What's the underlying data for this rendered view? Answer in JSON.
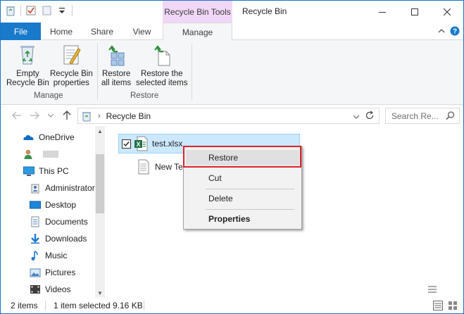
{
  "window": {
    "contextual_tab_group": "Recycle Bin Tools",
    "title": "Recycle Bin",
    "controls": [
      "minimize-icon",
      "maximize-icon",
      "close-icon"
    ]
  },
  "tabs": {
    "file": "File",
    "home": "Home",
    "share": "Share",
    "view": "View",
    "manage": "Manage"
  },
  "ribbon": {
    "manage_group": {
      "label": "Manage",
      "empty_recycle_bin": [
        "Empty",
        "Recycle Bin"
      ],
      "recycle_bin_properties": [
        "Recycle Bin",
        "properties"
      ]
    },
    "restore_group": {
      "label": "Restore",
      "restore_all": [
        "Restore",
        "all items"
      ],
      "restore_selected": [
        "Restore the",
        "selected items"
      ]
    }
  },
  "address": {
    "path": "Recycle Bin",
    "search_placeholder": "Search Re..."
  },
  "navpane": {
    "items": [
      {
        "label": "OneDrive",
        "icon": "onedrive-icon"
      },
      {
        "label": "",
        "icon": "user-icon"
      },
      {
        "label": "This PC",
        "icon": "this-pc-icon"
      },
      {
        "label": "Administrator",
        "icon": "user-folder-icon"
      },
      {
        "label": "Desktop",
        "icon": "desktop-icon"
      },
      {
        "label": "Documents",
        "icon": "documents-icon"
      },
      {
        "label": "Downloads",
        "icon": "downloads-icon"
      },
      {
        "label": "Music",
        "icon": "music-icon"
      },
      {
        "label": "Pictures",
        "icon": "pictures-icon"
      },
      {
        "label": "Videos",
        "icon": "videos-icon"
      }
    ]
  },
  "files": [
    {
      "name": "test.xlsx",
      "icon": "excel-file-icon",
      "selected": true,
      "checked": true
    },
    {
      "name": "New Tex",
      "icon": "text-file-icon",
      "selected": false,
      "checked": false
    }
  ],
  "context_menu": {
    "items": [
      "Restore",
      "Cut",
      "Delete",
      "Properties"
    ]
  },
  "status": {
    "item_count": "2 items",
    "selection": "1 item selected",
    "size": "9.16 KB"
  },
  "colors": {
    "accent": "#1979ca",
    "contextual_tab": "#f1d7f7",
    "selection": "#cce8ff",
    "highlight_box": "#e0212c"
  }
}
